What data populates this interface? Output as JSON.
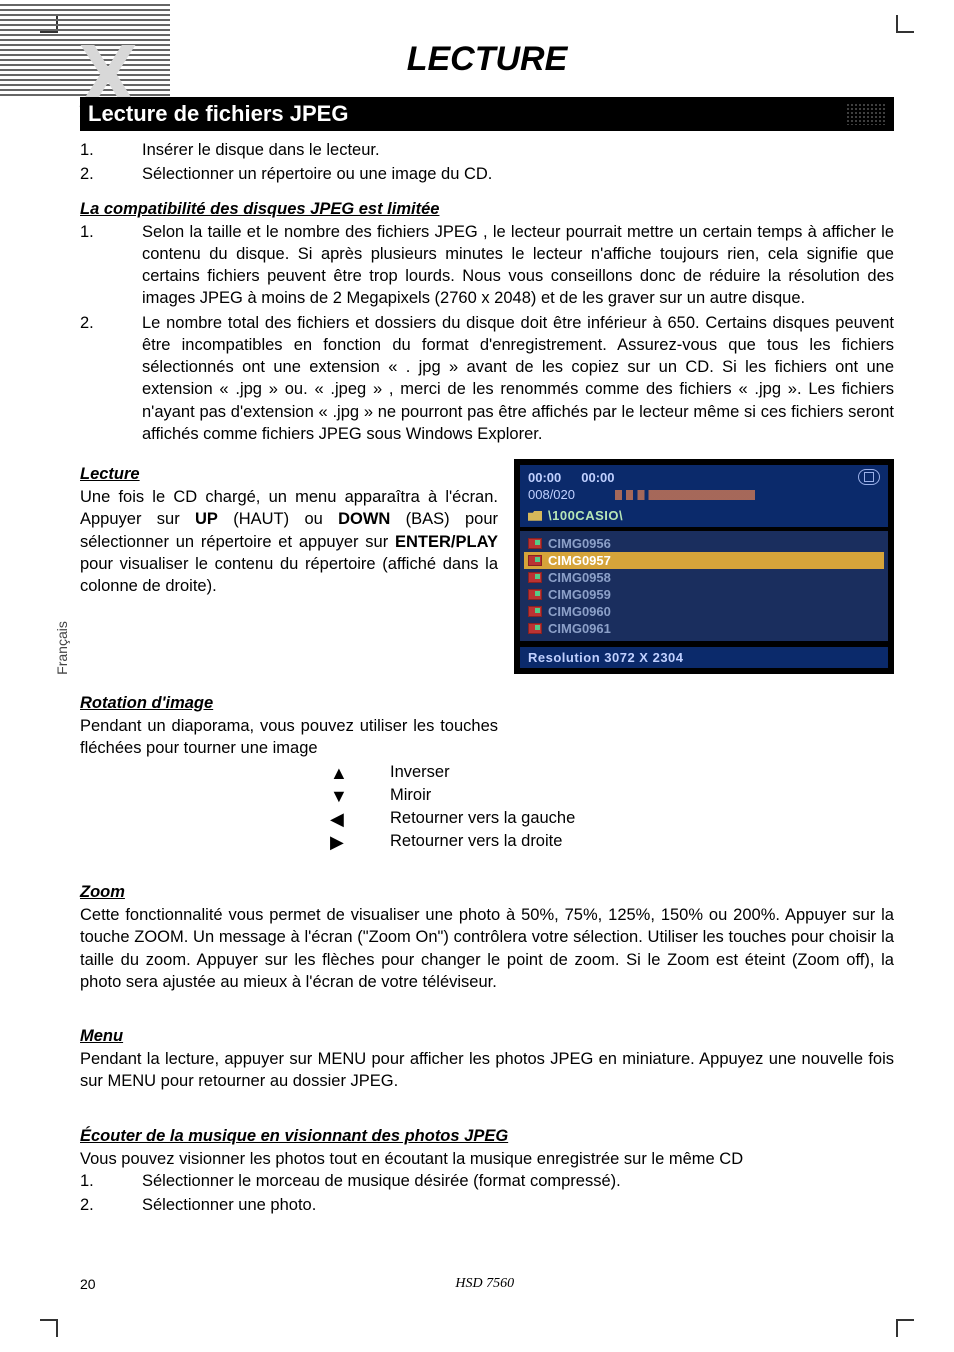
{
  "page_title": "LECTURE",
  "section_bar": "Lecture de fichiers JPEG",
  "language_tab": "Français",
  "intro_list": [
    {
      "num": "1.",
      "text": "Insérer le disque dans le lecteur."
    },
    {
      "num": "2.",
      "text": "Sélectionner un répertoire ou une image du CD."
    }
  ],
  "compat_head": "La compatibilité des disques JPEG est limitée",
  "compat_list": [
    {
      "num": "1.",
      "text": "Selon la taille et le nombre des fichiers JPEG , le lecteur pourrait mettre un certain temps à afficher le contenu du disque.  Si après plusieurs minutes le lecteur n'affiche toujours rien, cela signifie que certains fichiers peuvent être trop lourds. Nous vous conseillons donc de réduire la résolution des images JPEG à moins de 2 Megapixels (2760 x 2048) et de les graver sur un autre disque."
    },
    {
      "num": "2.",
      "text": "Le nombre total des fichiers et dossiers du disque doit être inférieur à 650.  Certains disques peuvent être incompatibles en fonction du format d'enregistrement.  Assurez-vous que tous les fichiers sélectionnés ont une extension « . jpg  » avant de les copiez sur un CD. Si les fichiers ont une extension « .jpg » ou. « .jpeg » , merci de les renommés comme des fichiers « .jpg ».  Les fichiers n'ayant pas d'extension « .jpg » ne pourront pas être affichés par le lecteur même si ces fichiers seront affichés comme fichiers JPEG sous Windows Explorer."
    }
  ],
  "lecture_head": "Lecture",
  "lecture_text_prefix": "Une fois le CD chargé, un menu apparaîtra à l'écran. Appuyer sur ",
  "lecture_bold_up": "UP",
  "lecture_mid1": " (HAUT) ou ",
  "lecture_bold_down": "DOWN",
  "lecture_mid2": " (BAS) pour sélectionner un répertoire et appuyer sur ",
  "lecture_bold_enter": "ENTER/PLAY",
  "lecture_suffix": " pour visualiser le contenu du répertoire (affiché dans la colonne de droite).",
  "rotation_head": "Rotation d'image",
  "rotation_text": "Pendant un diaporama, vous pouvez utiliser les touches fléchées pour tourner une image",
  "arrows": [
    {
      "sym": "▲",
      "label": "Inverser"
    },
    {
      "sym": "▼",
      "label": "Miroir"
    },
    {
      "sym": "◀",
      "label": "Retourner vers la gauche"
    },
    {
      "sym": "▶",
      "label": "Retourner vers la droite"
    }
  ],
  "zoom_head": "Zoom",
  "zoom_text": "Cette fonctionnalité vous permet de visualiser une photo à 50%, 75%, 125%, 150% ou 200%.  Appuyer sur la touche ZOOM. Un message à l'écran  (\"Zoom On\") contrôlera votre sélection. Utiliser les touches pour choisir la taille du zoom. Appuyer sur les flèches pour changer le point de zoom.  Si le Zoom est éteint (Zoom off), la photo sera ajustée au mieux  à l'écran de votre téléviseur.",
  "menu_head": "Menu",
  "menu_text": "Pendant la lecture, appuyer sur MENU pour afficher les photos JPEG en miniature. Appuyez une nouvelle fois sur MENU pour retourner au dossier JPEG.",
  "music_head": "Écouter de la musique en visionnant des photos JPEG",
  "music_intro": "Vous pouvez visionner les photos tout en écoutant la musique enregistrée sur le même CD",
  "music_list": [
    {
      "num": "1.",
      "text": "Sélectionner le morceau de musique désirée (format compressé)."
    },
    {
      "num": "2.",
      "text": "Sélectionner une photo."
    }
  ],
  "page_number": "20",
  "model": "HSD 7560",
  "screenshot": {
    "time_elapsed": "00:00",
    "time_total": "00:00",
    "counter": "008/020",
    "folder_name": "\\100CASIO\\",
    "files": [
      {
        "name": "CIMG0956",
        "selected": false
      },
      {
        "name": "CIMG0957",
        "selected": true
      },
      {
        "name": "CIMG0958",
        "selected": false
      },
      {
        "name": "CIMG0959",
        "selected": false
      },
      {
        "name": "CIMG0960",
        "selected": false
      },
      {
        "name": "CIMG0961",
        "selected": false
      }
    ],
    "resolution_label": "Resolution  3072  X  2304"
  }
}
